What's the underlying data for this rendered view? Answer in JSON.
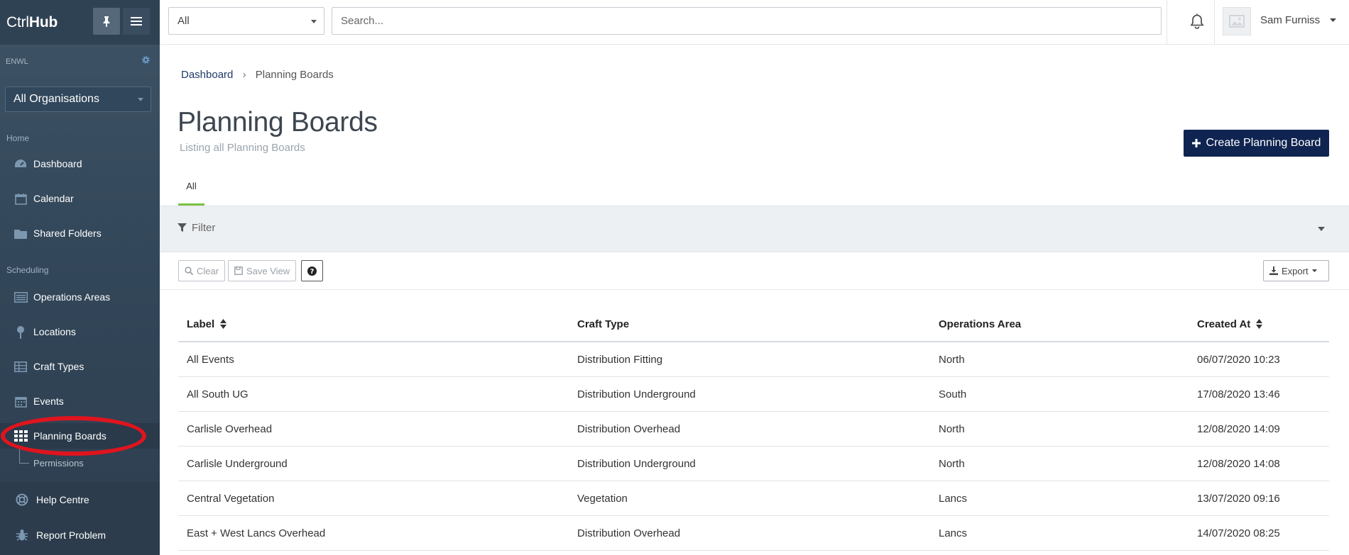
{
  "brand": {
    "logo_prefix": "Ctrl",
    "logo_bold": "Hub"
  },
  "organisation": {
    "code": "ENWL",
    "selected": "All Organisations"
  },
  "topbar": {
    "scope_selected": "All",
    "search_placeholder": "Search...",
    "username": "Sam Furniss"
  },
  "sidebar": {
    "sections": {
      "home": "Home",
      "scheduling": "Scheduling"
    },
    "items": {
      "dashboard": "Dashboard",
      "calendar": "Calendar",
      "shared_folders": "Shared Folders",
      "operations_areas": "Operations Areas",
      "locations": "Locations",
      "craft_types": "Craft Types",
      "events": "Events",
      "planning_boards": "Planning Boards",
      "permissions": "Permissions",
      "help_centre": "Help Centre",
      "report_problem": "Report Problem"
    },
    "active": "planning_boards"
  },
  "breadcrumb": {
    "root": "Dashboard",
    "current": "Planning Boards"
  },
  "page": {
    "title": "Planning Boards",
    "subtitle": "Listing all Planning Boards",
    "create_label": "Create Planning Board"
  },
  "tabs": {
    "all": "All"
  },
  "filter": {
    "label": "Filter"
  },
  "toolbar": {
    "clear": "Clear",
    "save_view": "Save View",
    "export": "Export"
  },
  "table": {
    "columns": {
      "label": "Label",
      "craft_type": "Craft Type",
      "operations_area": "Operations Area",
      "created_at": "Created At"
    },
    "rows": [
      {
        "label": "All Events",
        "craft_type": "Distribution Fitting",
        "operations_area": "North",
        "created_at": "06/07/2020 10:23"
      },
      {
        "label": "All South UG",
        "craft_type": "Distribution Underground",
        "operations_area": "South",
        "created_at": "17/08/2020 13:46"
      },
      {
        "label": "Carlisle Overhead",
        "craft_type": "Distribution Overhead",
        "operations_area": "North",
        "created_at": "12/08/2020 14:09"
      },
      {
        "label": "Carlisle Underground",
        "craft_type": "Distribution Underground",
        "operations_area": "North",
        "created_at": "12/08/2020 14:08"
      },
      {
        "label": "Central Vegetation",
        "craft_type": "Vegetation",
        "operations_area": "Lancs",
        "created_at": "13/07/2020 09:16"
      },
      {
        "label": "East + West Lancs Overhead",
        "craft_type": "Distribution Overhead",
        "operations_area": "Lancs",
        "created_at": "14/07/2020 08:25"
      }
    ]
  },
  "colors": {
    "sidebar": "#33475a",
    "primary_button": "#0f2450",
    "tab_accent": "#7ac142",
    "annotation": "#e0141e"
  }
}
